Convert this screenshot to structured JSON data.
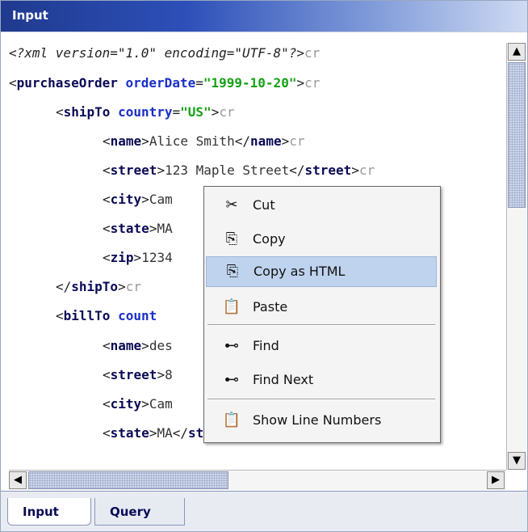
{
  "window": {
    "title": "Input"
  },
  "editor": {
    "lines": [
      {
        "indent": "",
        "parts": [
          {
            "c": "pi",
            "t": "<?xml version=\"1.0\" encoding=\"UTF-8\"?>"
          },
          {
            "c": "cr",
            "t": "cr"
          }
        ]
      },
      {
        "indent": "",
        "parts": [
          {
            "c": "bkt",
            "t": "<"
          },
          {
            "c": "tag",
            "t": "purchaseOrder"
          },
          {
            "c": "txt",
            "t": " "
          },
          {
            "c": "attr",
            "t": "orderDate"
          },
          {
            "c": "bkt",
            "t": "="
          },
          {
            "c": "val",
            "t": "\"1999-10-20\""
          },
          {
            "c": "bkt",
            "t": ">"
          },
          {
            "c": "cr",
            "t": "cr"
          }
        ]
      },
      {
        "indent": "    ",
        "parts": [
          {
            "c": "bkt",
            "t": "<"
          },
          {
            "c": "tag",
            "t": "shipTo"
          },
          {
            "c": "txt",
            "t": " "
          },
          {
            "c": "attr",
            "t": "country"
          },
          {
            "c": "bkt",
            "t": "="
          },
          {
            "c": "val",
            "t": "\"US\""
          },
          {
            "c": "bkt",
            "t": ">"
          },
          {
            "c": "cr",
            "t": "cr"
          }
        ]
      },
      {
        "indent": "        ",
        "parts": [
          {
            "c": "bkt",
            "t": "<"
          },
          {
            "c": "tag",
            "t": "name"
          },
          {
            "c": "bkt",
            "t": ">"
          },
          {
            "c": "txt",
            "t": "Alice Smith"
          },
          {
            "c": "bkt",
            "t": "</"
          },
          {
            "c": "tag",
            "t": "name"
          },
          {
            "c": "bkt",
            "t": ">"
          },
          {
            "c": "cr",
            "t": "cr"
          }
        ]
      },
      {
        "indent": "        ",
        "parts": [
          {
            "c": "bkt",
            "t": "<"
          },
          {
            "c": "tag",
            "t": "street"
          },
          {
            "c": "bkt",
            "t": ">"
          },
          {
            "c": "txt",
            "t": "123 Maple Street"
          },
          {
            "c": "bkt",
            "t": "</"
          },
          {
            "c": "tag",
            "t": "street"
          },
          {
            "c": "bkt",
            "t": ">"
          },
          {
            "c": "cr",
            "t": "cr"
          }
        ]
      },
      {
        "indent": "        ",
        "parts": [
          {
            "c": "bkt",
            "t": "<"
          },
          {
            "c": "tag",
            "t": "city"
          },
          {
            "c": "bkt",
            "t": ">"
          },
          {
            "c": "txt",
            "t": "Cam"
          }
        ]
      },
      {
        "indent": "        ",
        "parts": [
          {
            "c": "bkt",
            "t": "<"
          },
          {
            "c": "tag",
            "t": "state"
          },
          {
            "c": "bkt",
            "t": ">"
          },
          {
            "c": "txt",
            "t": "MA"
          }
        ]
      },
      {
        "indent": "        ",
        "parts": [
          {
            "c": "bkt",
            "t": "<"
          },
          {
            "c": "tag",
            "t": "zip"
          },
          {
            "c": "bkt",
            "t": ">"
          },
          {
            "c": "txt",
            "t": "1234"
          }
        ]
      },
      {
        "indent": "    ",
        "parts": [
          {
            "c": "bkt",
            "t": "</"
          },
          {
            "c": "tag",
            "t": "shipTo"
          },
          {
            "c": "bkt",
            "t": ">"
          },
          {
            "c": "cr",
            "t": "cr"
          }
        ]
      },
      {
        "indent": "    ",
        "parts": [
          {
            "c": "bkt",
            "t": "<"
          },
          {
            "c": "tag",
            "t": "billTo"
          },
          {
            "c": "txt",
            "t": " "
          },
          {
            "c": "attr",
            "t": "count"
          }
        ]
      },
      {
        "indent": "        ",
        "parts": [
          {
            "c": "bkt",
            "t": "<"
          },
          {
            "c": "tag",
            "t": "name"
          },
          {
            "c": "bkt",
            "t": ">"
          },
          {
            "c": "txt",
            "t": "des"
          }
        ]
      },
      {
        "indent": "        ",
        "parts": [
          {
            "c": "bkt",
            "t": "<"
          },
          {
            "c": "tag",
            "t": "street"
          },
          {
            "c": "bkt",
            "t": ">"
          },
          {
            "c": "txt",
            "t": "8"
          }
        ]
      },
      {
        "indent": "        ",
        "parts": [
          {
            "c": "bkt",
            "t": "<"
          },
          {
            "c": "tag",
            "t": "city"
          },
          {
            "c": "bkt",
            "t": ">"
          },
          {
            "c": "txt",
            "t": "Cam"
          }
        ]
      },
      {
        "indent": "        ",
        "parts": [
          {
            "c": "bkt",
            "t": "<"
          },
          {
            "c": "tag",
            "t": "state"
          },
          {
            "c": "bkt",
            "t": ">"
          },
          {
            "c": "txt",
            "t": "MA"
          },
          {
            "c": "bkt",
            "t": "</"
          },
          {
            "c": "tag",
            "t": "state"
          },
          {
            "c": "bkt",
            "t": ">"
          },
          {
            "c": "cr",
            "t": "cr"
          }
        ]
      }
    ]
  },
  "context_menu": {
    "items": [
      {
        "label": "Cut",
        "icon": "scissors-icon",
        "glyph": "✂",
        "highlighted": false
      },
      {
        "label": "Copy",
        "icon": "copy-icon",
        "glyph": "⎘",
        "highlighted": false
      },
      {
        "label": "Copy as HTML",
        "icon": "copy-html-icon",
        "glyph": "⎘",
        "highlighted": true
      },
      {
        "label": "Paste",
        "icon": "paste-icon",
        "glyph": "📋",
        "highlighted": false
      },
      {
        "label": "Find",
        "icon": "binoculars-icon",
        "glyph": "⊷",
        "highlighted": false
      },
      {
        "label": "Find Next",
        "icon": "binoculars-icon",
        "glyph": "⊷",
        "highlighted": false
      },
      {
        "label": "Show Line Numbers",
        "icon": "clipboard-icon",
        "glyph": "📋",
        "highlighted": false
      }
    ]
  },
  "scrollbars": {
    "up": "▲",
    "down": "▼",
    "left": "◀",
    "right": "▶"
  },
  "tabs": [
    {
      "label": "Input",
      "active": true
    },
    {
      "label": "Query",
      "active": false
    }
  ],
  "colors": {
    "title_bar": "#1f3a8e",
    "menu_highlight": "#bfd3ee",
    "tag": "#0a0a55",
    "attr": "#1a2fc8",
    "value": "#16a016"
  }
}
